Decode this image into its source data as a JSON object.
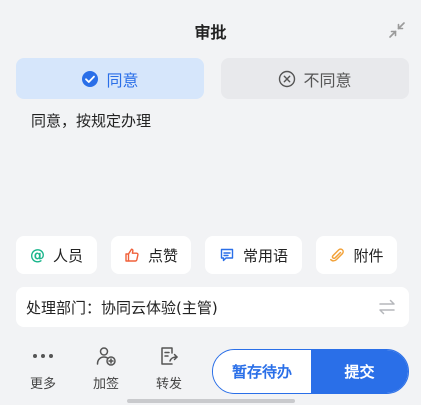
{
  "header": {
    "title": "审批"
  },
  "choices": {
    "agree": "同意",
    "disagree": "不同意"
  },
  "comment": "同意，按规定办理",
  "tools": {
    "people": "人员",
    "like": "点赞",
    "phrases": "常用语",
    "attachment": "附件"
  },
  "department": {
    "label": "处理部门：协同云体验(主管)"
  },
  "bottom": {
    "more": "更多",
    "add_sign": "加签",
    "forward": "转发",
    "save_pending": "暂存待办",
    "submit": "提交"
  },
  "colors": {
    "accent": "#2a6fe8",
    "agree_bg": "#d6e6fb",
    "like_red": "#f0603a",
    "attach_orange": "#f2a23a",
    "people_green": "#19b58b"
  },
  "icons": [
    "collapse-icon",
    "check-circle-icon",
    "close-circle-icon",
    "at-icon",
    "thumbs-up-icon",
    "message-icon",
    "paperclip-icon",
    "swap-icon",
    "more-icon",
    "add-user-icon",
    "forward-icon"
  ]
}
